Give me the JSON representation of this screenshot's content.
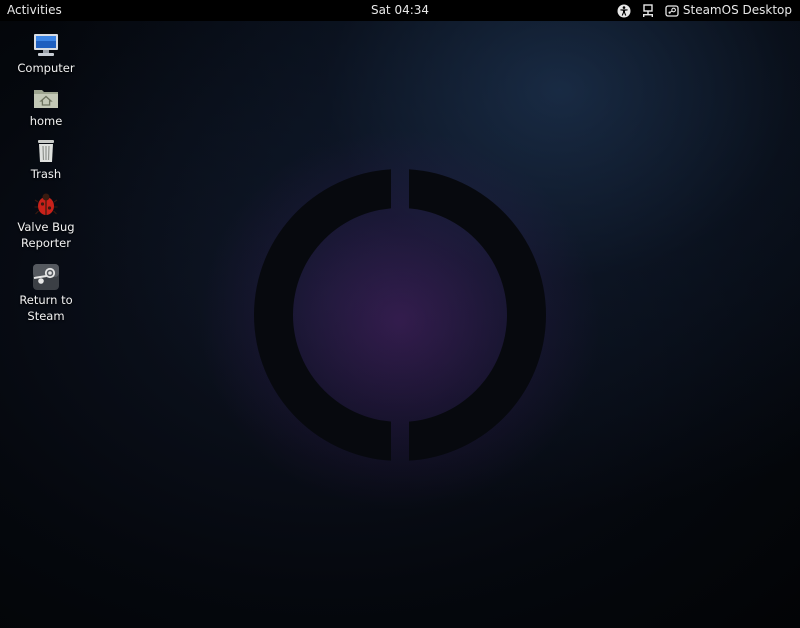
{
  "top_bar": {
    "activities_label": "Activities",
    "clock": "Sat 04:34",
    "tray": {
      "accessibility_icon": "accessibility-icon",
      "network_icon": "network-wired-icon",
      "user_icon": "steam-user-icon",
      "user_label": "SteamOS Desktop"
    }
  },
  "desktop": {
    "icons": [
      {
        "label": "Computer",
        "icon": "computer-icon"
      },
      {
        "label": "home",
        "icon": "home-folder-icon"
      },
      {
        "label": "Trash",
        "icon": "trash-icon"
      },
      {
        "label": "Valve Bug Reporter",
        "icon": "bug-reporter-icon"
      },
      {
        "label": "Return to Steam",
        "icon": "steam-icon"
      }
    ]
  },
  "colors": {
    "panel_bg": "#000000",
    "panel_text": "#e8e8e8",
    "desktop_glow_blue": "#28466e",
    "desktop_glow_purple": "#782896",
    "logo_ring": "#07090e"
  }
}
